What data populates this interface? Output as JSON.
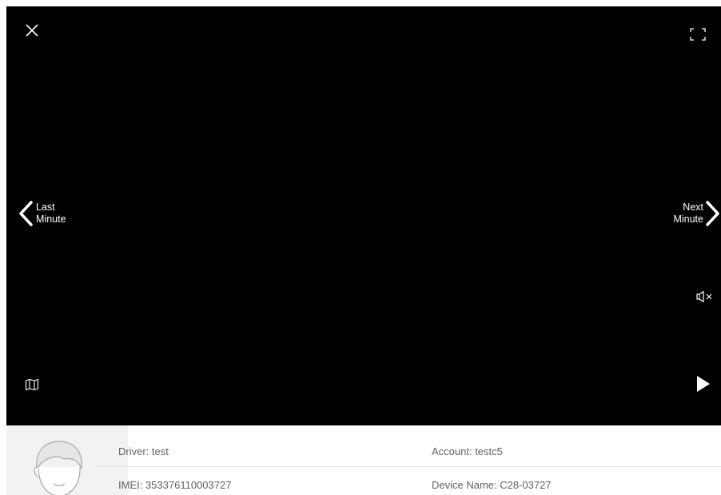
{
  "player": {
    "prev": {
      "label": "Last\nMinute",
      "icon": "chevron-left-icon"
    },
    "next": {
      "label": "Next\nMinute",
      "icon": "chevron-right-icon"
    },
    "controls": {
      "close_icon": "close-icon",
      "fullscreen_icon": "fullscreen-icon",
      "mute_icon": "volume-muted-icon",
      "map_icon": "map-icon",
      "play_icon": "play-icon"
    },
    "colors": {
      "background": "#000000",
      "foreground": "#ffffff"
    }
  },
  "info": {
    "driver": "Driver: test",
    "account": "Account: testc5",
    "imei": "IMEI: 353376110003727",
    "device_name": "Device Name: C28-03727"
  }
}
